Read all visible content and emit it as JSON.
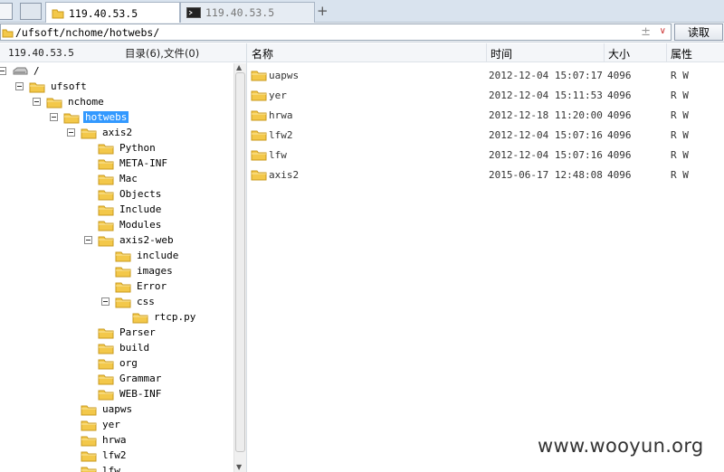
{
  "tabs": [
    {
      "label": "119.40.53.5",
      "active": true,
      "icon": "folder-icon"
    },
    {
      "label": "119.40.53.5",
      "active": false,
      "icon": "terminal-icon"
    }
  ],
  "new_tab": "+",
  "address": {
    "path": "/ufsoft/nchome/hotwebs/",
    "clear_glyph": "±",
    "dropdown_glyph": "∨",
    "read_button": "读取"
  },
  "left_panel": {
    "host": "119.40.53.5",
    "counts": "目录(6),文件(0)"
  },
  "tree": [
    {
      "name": "/",
      "type": "drive",
      "toggle": true
    },
    {
      "name": "ufsoft",
      "type": "folder",
      "toggle": true
    },
    {
      "name": "nchome",
      "type": "folder",
      "toggle": true
    },
    {
      "name": "hotwebs",
      "type": "folder",
      "toggle": true,
      "selected": true
    },
    {
      "name": "axis2",
      "type": "folder",
      "toggle": true
    },
    {
      "name": "Python",
      "type": "folder"
    },
    {
      "name": "META-INF",
      "type": "folder"
    },
    {
      "name": "Mac",
      "type": "folder"
    },
    {
      "name": "Objects",
      "type": "folder"
    },
    {
      "name": "Include",
      "type": "folder"
    },
    {
      "name": "Modules",
      "type": "folder"
    },
    {
      "name": "axis2-web",
      "type": "folder",
      "toggle": true
    },
    {
      "name": "include",
      "type": "folder"
    },
    {
      "name": "images",
      "type": "folder"
    },
    {
      "name": "Error",
      "type": "folder"
    },
    {
      "name": "css",
      "type": "folder",
      "toggle": true
    },
    {
      "name": "rtcp.py",
      "type": "folder"
    },
    {
      "name": "Parser",
      "type": "folder"
    },
    {
      "name": "build",
      "type": "folder"
    },
    {
      "name": "org",
      "type": "folder"
    },
    {
      "name": "Grammar",
      "type": "folder"
    },
    {
      "name": "WEB-INF",
      "type": "folder"
    },
    {
      "name": "uapws",
      "type": "folder"
    },
    {
      "name": "yer",
      "type": "folder"
    },
    {
      "name": "hrwa",
      "type": "folder"
    },
    {
      "name": "lfw2",
      "type": "folder"
    },
    {
      "name": "lfw",
      "type": "folder"
    }
  ],
  "columns": {
    "name": "名称",
    "time": "时间",
    "size": "大小",
    "attr": "属性"
  },
  "files": [
    {
      "name": "uapws",
      "time": "2012-12-04 15:07:17",
      "size": "4096",
      "attr": "R W"
    },
    {
      "name": "yer",
      "time": "2012-12-04 15:11:53",
      "size": "4096",
      "attr": "R W"
    },
    {
      "name": "hrwa",
      "time": "2012-12-18 11:20:00",
      "size": "4096",
      "attr": "R W"
    },
    {
      "name": "lfw2",
      "time": "2012-12-04 15:07:16",
      "size": "4096",
      "attr": "R W"
    },
    {
      "name": "lfw",
      "time": "2012-12-04 15:07:16",
      "size": "4096",
      "attr": "R W"
    },
    {
      "name": "axis2",
      "time": "2015-06-17 12:48:08",
      "size": "4096",
      "attr": "R W"
    }
  ],
  "watermark": "www.wooyun.org",
  "colors": {
    "folder": "#f3c84a",
    "folder_edge": "#c99a1c",
    "selection": "#3399ff",
    "tab_bar": "#d9e3ee"
  }
}
